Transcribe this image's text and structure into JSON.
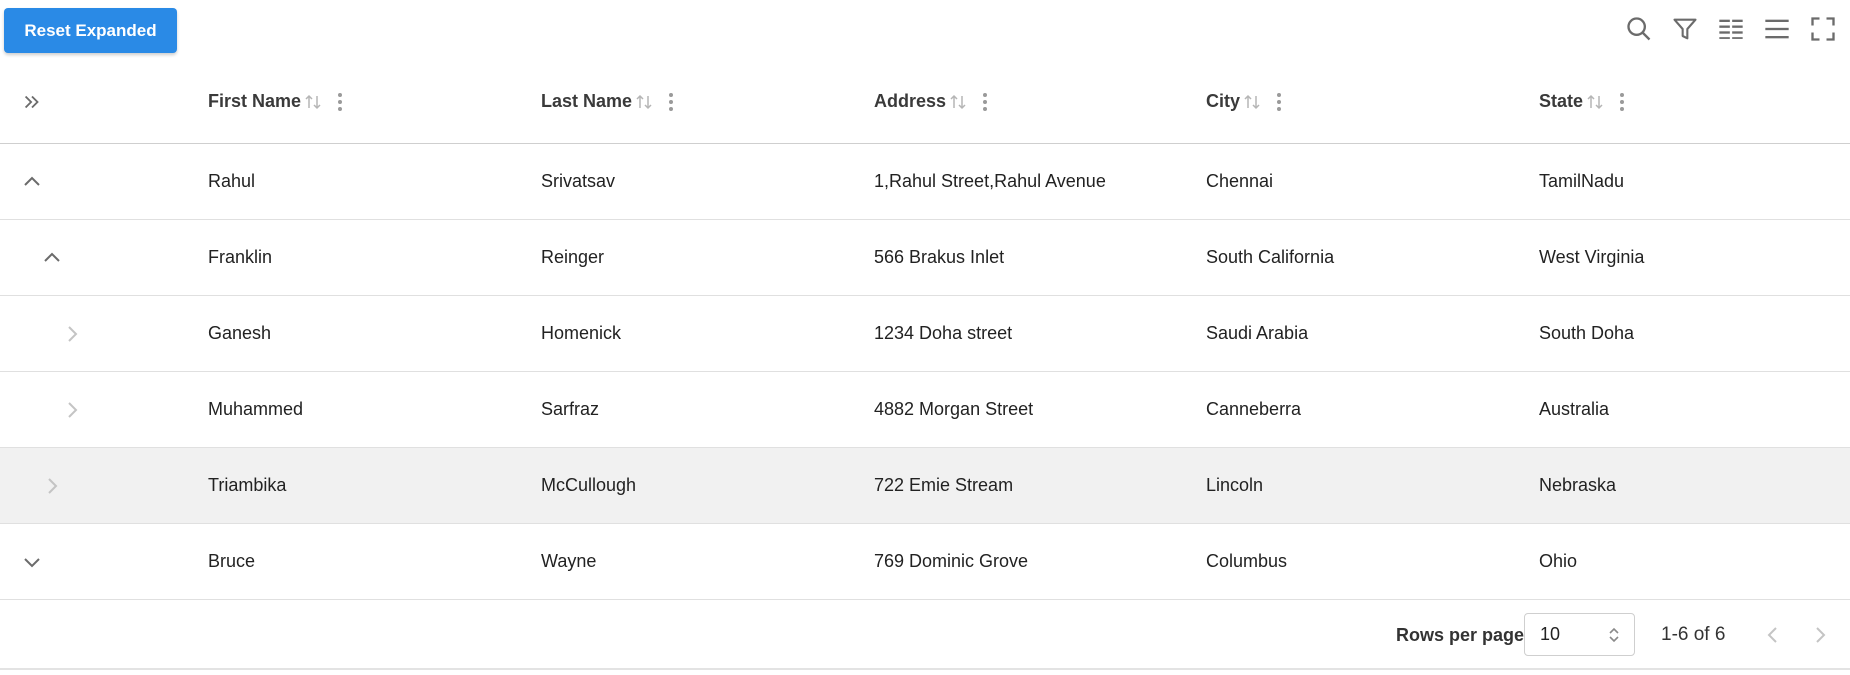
{
  "toolbar": {
    "reset_label": "Reset Expanded",
    "icons": [
      "search-icon",
      "filter-icon",
      "columns-icon",
      "density-icon",
      "fullscreen-icon"
    ]
  },
  "table": {
    "columns": [
      "First Name",
      "Last Name",
      "Address",
      "City",
      "State"
    ],
    "rows": [
      {
        "first": "Rahul",
        "last": "Srivatsav",
        "address": "1,Rahul Street,Rahul Avenue",
        "city": "Chennai",
        "state": "TamilNadu",
        "depth": 0,
        "state_icon": "chevron-up-icon"
      },
      {
        "first": "Franklin",
        "last": "Reinger",
        "address": "566 Brakus Inlet",
        "city": "South California",
        "state": "West Virginia",
        "depth": 1,
        "state_icon": "chevron-up-icon"
      },
      {
        "first": "Ganesh",
        "last": "Homenick",
        "address": "1234 Doha street",
        "city": "Saudi Arabia",
        "state": "South Doha",
        "depth": 2,
        "state_icon": "chevron-right-icon"
      },
      {
        "first": "Muhammed",
        "last": "Sarfraz",
        "address": "4882 Morgan Street",
        "city": "Canneberra",
        "state": "Australia",
        "depth": 2,
        "state_icon": "chevron-right-icon"
      },
      {
        "first": "Triambika",
        "last": "McCullough",
        "address": "722 Emie Stream",
        "city": "Lincoln",
        "state": "Nebraska",
        "depth": 1,
        "state_icon": "chevron-right-icon"
      },
      {
        "first": "Bruce",
        "last": "Wayne",
        "address": "769 Dominic Grove",
        "city": "Columbus",
        "state": "Ohio",
        "depth": 0,
        "state_icon": "chevron-down-icon"
      }
    ]
  },
  "footer": {
    "rows_per_page_label": "Rows per page",
    "rows_per_page_value": "10",
    "page_info": "1-6 of 6"
  },
  "colors": {
    "accent": "#2a8ae6",
    "hover_row": "#f1f1f1",
    "icon_gray": "#6b6b6b"
  }
}
